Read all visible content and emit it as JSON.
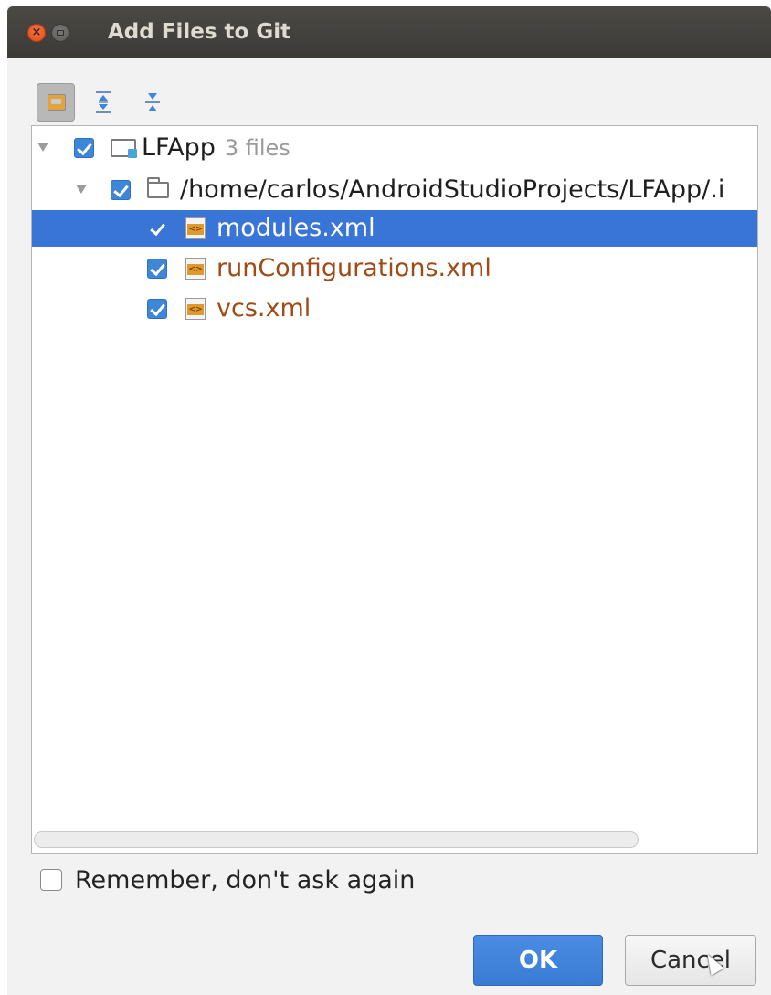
{
  "window": {
    "title": "Add Files to Git",
    "close_glyph": "×"
  },
  "toolbar": {
    "items": [
      {
        "name": "group-by-directory",
        "icon": "group-by-directory-icon"
      },
      {
        "name": "expand-all",
        "icon": "expand-all-icon"
      },
      {
        "name": "collapse-all",
        "icon": "collapse-all-icon"
      }
    ]
  },
  "tree": {
    "root": {
      "label": "LFApp",
      "hint": "3 files",
      "checked": true
    },
    "folder": {
      "label": "/home/carlos/AndroidStudioProjects/LFApp/.i",
      "checked": true
    },
    "files": [
      {
        "label": "modules.xml",
        "checked": true,
        "selected": true
      },
      {
        "label": "runConfigurations.xml",
        "checked": true,
        "selected": false
      },
      {
        "label": "vcs.xml",
        "checked": true,
        "selected": false
      }
    ]
  },
  "remember": {
    "label": "Remember, don't ask again",
    "checked": false
  },
  "buttons": {
    "ok": "OK",
    "cancel": "Cancel"
  },
  "colors": {
    "selection": "#3875d7",
    "checkbox": "#3d86d8",
    "file_text": "#a04a15",
    "ok_button": "#3a7bd5"
  }
}
